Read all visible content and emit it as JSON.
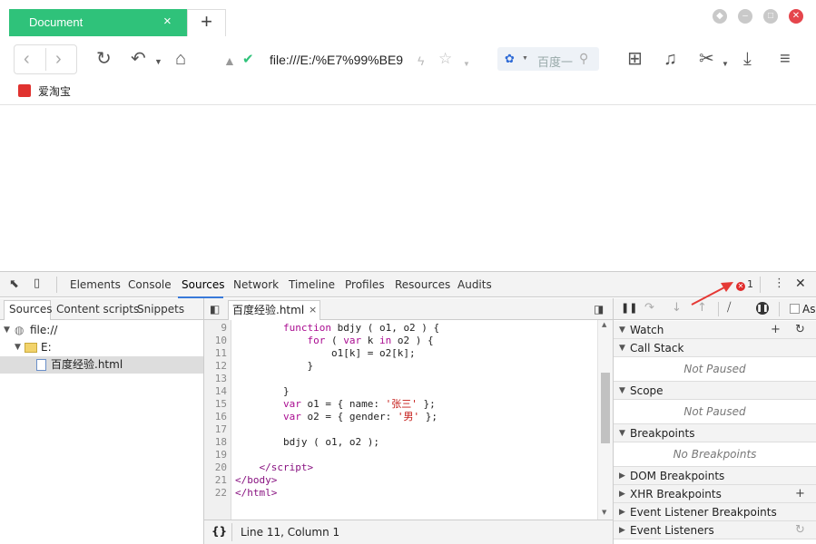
{
  "browser": {
    "tab_title": "Document",
    "tab_close": "×",
    "new_tab": "+",
    "url": "file:///E:/%E7%99%BE9",
    "search_placeholder": "百度一",
    "bookmark": "爱淘宝"
  },
  "devtools": {
    "tabs": [
      "Elements",
      "Console",
      "Sources",
      "Network",
      "Timeline",
      "Profiles",
      "Resources",
      "Audits"
    ],
    "active_tab": "Sources",
    "error_count": "1",
    "nav_tabs": [
      "Sources",
      "Content scripts",
      "Snippets"
    ],
    "tree": {
      "root": "file://",
      "folder": "E:",
      "file": "百度经验.html"
    },
    "editor": {
      "file_tab": "百度经验.html",
      "line_numbers": [
        "9",
        "10",
        "11",
        "12",
        "13",
        "14",
        "15",
        "16",
        "17",
        "18",
        "19",
        "20",
        "21",
        "22"
      ],
      "status": "Line 11, Column 1",
      "format_label": "{}"
    },
    "sidebar": {
      "as_label": "As",
      "watch": "Watch",
      "call_stack": "Call Stack",
      "not_paused": "Not Paused",
      "scope": "Scope",
      "not_paused_2": "Not Paused",
      "breakpoints": "Breakpoints",
      "no_breakpoints": "No Breakpoints",
      "dom_breakpoints": "DOM Breakpoints",
      "xhr_breakpoints": "XHR Breakpoints",
      "event_listener_breakpoints": "Event Listener Breakpoints",
      "event_listeners": "Event Listeners"
    }
  },
  "colors": {
    "tab_green": "#2fc27a",
    "accent_blue": "#3879d9",
    "error_red": "#e02b2b"
  }
}
